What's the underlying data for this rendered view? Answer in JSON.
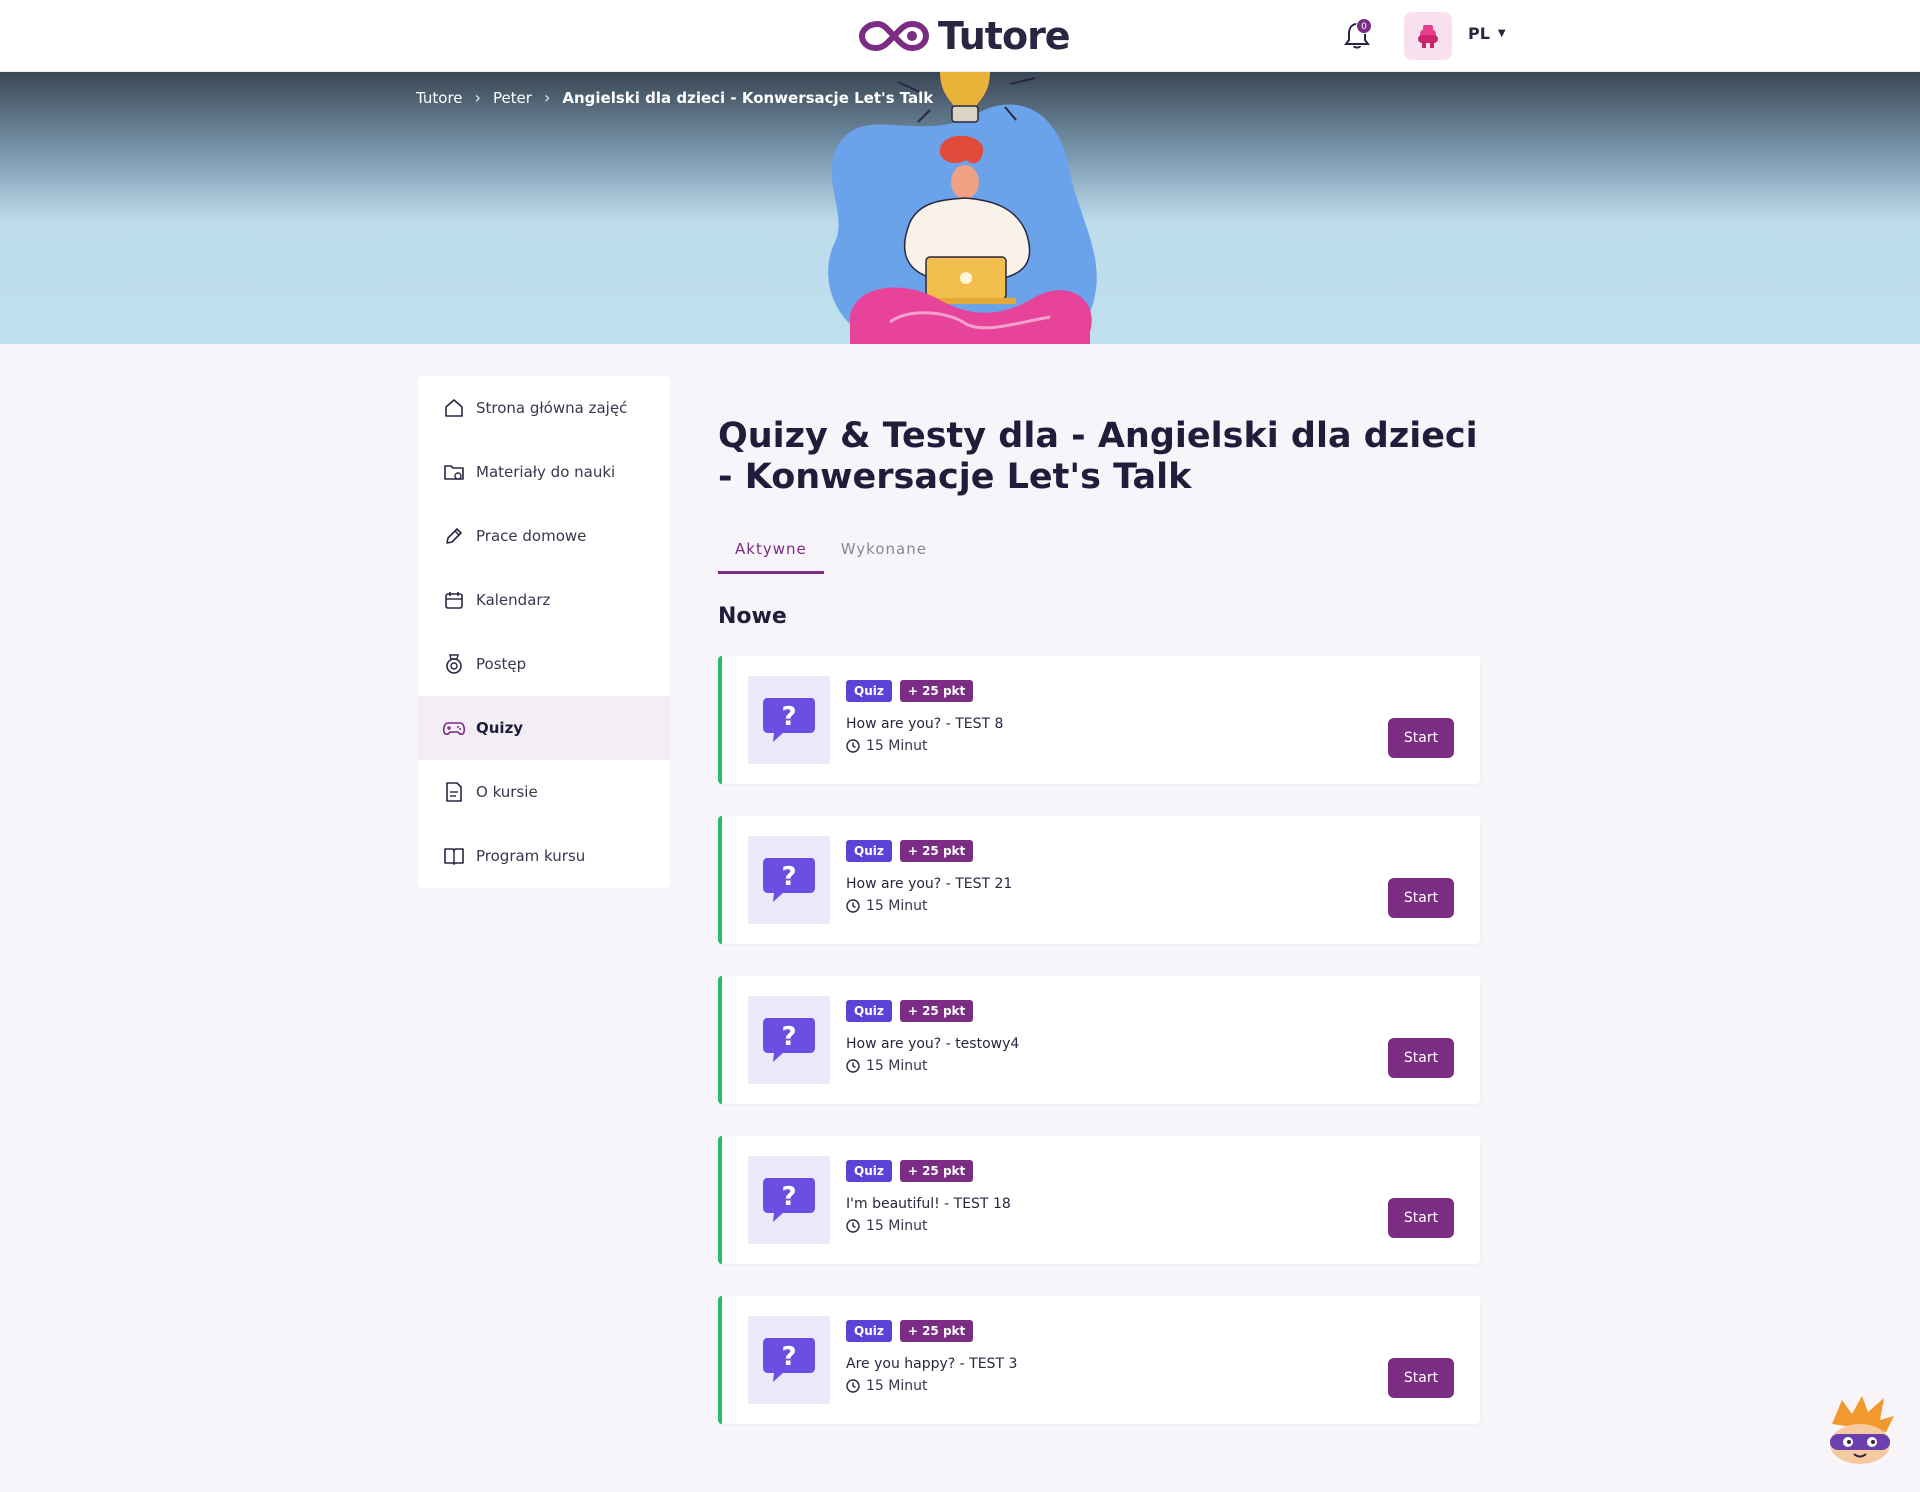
{
  "brand": {
    "name": "Tutore",
    "color": "#7b2c83"
  },
  "header": {
    "notifications_count": "0",
    "language": "PL"
  },
  "breadcrumb": [
    {
      "label": "Tutore"
    },
    {
      "label": "Peter"
    },
    {
      "label": "Angielski dla dzieci - Konwersacje Let's Talk"
    }
  ],
  "sidebar": {
    "items": [
      {
        "label": "Strona główna zajęć",
        "icon": "home-icon"
      },
      {
        "label": "Materiały do nauki",
        "icon": "folder-icon"
      },
      {
        "label": "Prace domowe",
        "icon": "pencil-icon"
      },
      {
        "label": "Kalendarz",
        "icon": "calendar-icon"
      },
      {
        "label": "Postęp",
        "icon": "medal-icon"
      },
      {
        "label": "Quizy",
        "icon": "gamepad-icon",
        "active": true
      },
      {
        "label": "O kursie",
        "icon": "document-icon"
      },
      {
        "label": "Program kursu",
        "icon": "book-icon"
      }
    ]
  },
  "main": {
    "title": "Quizy & Testy dla - Angielski dla dzieci - Konwersacje Let's Talk",
    "tabs": [
      {
        "label": "Aktywne",
        "active": true
      },
      {
        "label": "Wykonane",
        "active": false
      }
    ],
    "section_title": "Nowe",
    "quizzes": [
      {
        "type": "Quiz",
        "points": "+ 25 pkt",
        "title": "How are you? - TEST 8",
        "duration": "15 Minut",
        "button": "Start"
      },
      {
        "type": "Quiz",
        "points": "+ 25 pkt",
        "title": "How are you? - TEST 21",
        "duration": "15 Minut",
        "button": "Start"
      },
      {
        "type": "Quiz",
        "points": "+ 25 pkt",
        "title": "How are you? - testowy4",
        "duration": "15 Minut",
        "button": "Start"
      },
      {
        "type": "Quiz",
        "points": "+ 25 pkt",
        "title": "I'm beautiful! - TEST 18",
        "duration": "15 Minut",
        "button": "Start"
      },
      {
        "type": "Quiz",
        "points": "+ 25 pkt",
        "title": "Are you happy? - TEST 3",
        "duration": "15 Minut",
        "button": "Start"
      }
    ]
  },
  "colors": {
    "accent": "#7b2c83",
    "quiz_badge": "#5a43d6",
    "card_border": "#28b96e"
  }
}
